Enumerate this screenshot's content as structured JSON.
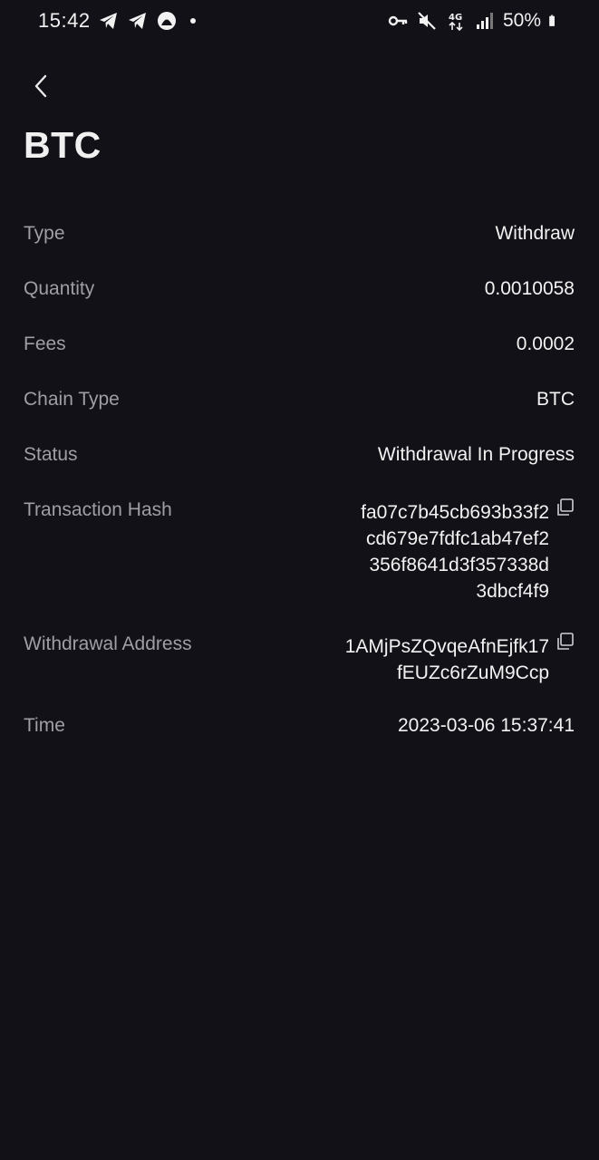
{
  "status_bar": {
    "time": "15:42",
    "battery": "50%",
    "icons_left": [
      "telegram-icon",
      "telegram-icon",
      "app-icon",
      "notification-dot"
    ],
    "icons_right": [
      "key-icon",
      "mute-icon",
      "4g-icon",
      "signal-icon",
      "battery-icon"
    ]
  },
  "header": {
    "back_icon": "chevron-left-icon",
    "title": "BTC"
  },
  "details": {
    "type": {
      "label": "Type",
      "value": "Withdraw"
    },
    "quantity": {
      "label": "Quantity",
      "value": "0.0010058"
    },
    "fees": {
      "label": "Fees",
      "value": "0.0002"
    },
    "chain_type": {
      "label": "Chain Type",
      "value": "BTC"
    },
    "status": {
      "label": "Status",
      "value": "Withdrawal In Progress"
    },
    "tx_hash": {
      "label": "Transaction Hash",
      "lines": [
        "fa07c7b45cb693b33f2",
        "cd679e7fdfc1ab47ef2",
        "356f8641d3f357338d",
        "3dbcf4f9"
      ],
      "copy_icon": "copy-icon"
    },
    "withdrawal_address": {
      "label": "Withdrawal Address",
      "lines": [
        "1AMjPsZQvqeAfnEjfk17",
        "fEUZc6rZuM9Ccp"
      ],
      "copy_icon": "copy-icon"
    },
    "time": {
      "label": "Time",
      "value": "2023-03-06 15:37:41"
    }
  },
  "colors": {
    "background": "#121117",
    "label": "#9E9EA6",
    "value": "#F2F2F2"
  }
}
